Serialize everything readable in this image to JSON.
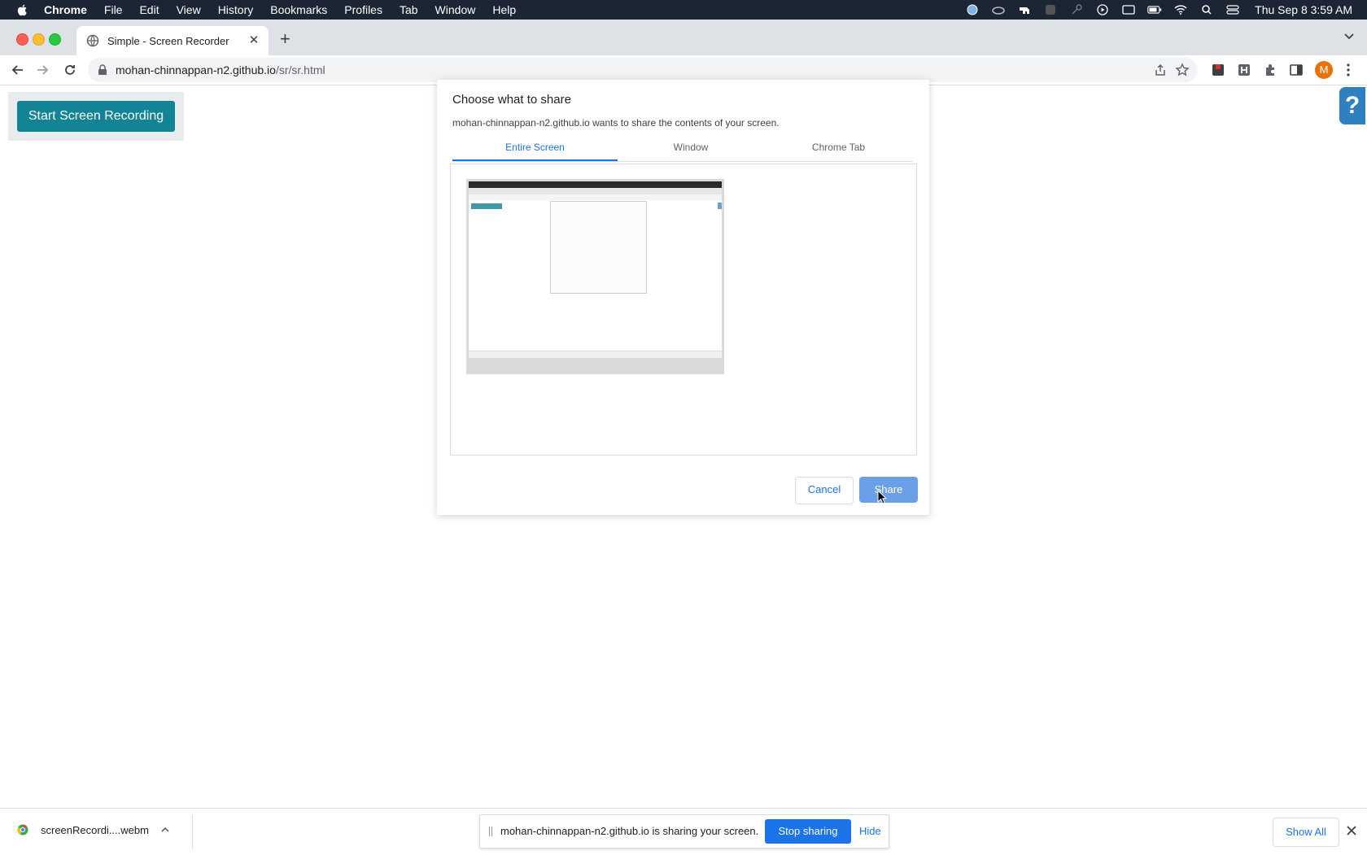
{
  "menubar": {
    "app": "Chrome",
    "items": [
      "File",
      "Edit",
      "View",
      "History",
      "Bookmarks",
      "Profiles",
      "Tab",
      "Window",
      "Help"
    ],
    "clock": "Thu Sep 8  3:59 AM"
  },
  "browser": {
    "tab_title": "Simple - Screen Recorder",
    "url_host": "mohan-chinnappan-n2.github.io",
    "url_path": "/sr/sr.html",
    "profile_initial": "M"
  },
  "page": {
    "start_button": "Start Screen Recording",
    "help_button": "?"
  },
  "dialog": {
    "title": "Choose what to share",
    "subtitle": "mohan-chinnappan-n2.github.io wants to share the contents of your screen.",
    "tabs": [
      {
        "label": "Entire Screen",
        "active": true
      },
      {
        "label": "Window",
        "active": false
      },
      {
        "label": "Chrome Tab",
        "active": false
      }
    ],
    "cancel": "Cancel",
    "share": "Share"
  },
  "downloads": {
    "file_name": "screenRecordi....webm",
    "share_message": "mohan-chinnappan-n2.github.io is sharing your screen.",
    "stop_sharing": "Stop sharing",
    "hide": "Hide",
    "show_all": "Show All"
  },
  "colors": {
    "accent": "#1a73e8",
    "start_button": "#138496",
    "help_button": "#2f80c0"
  }
}
